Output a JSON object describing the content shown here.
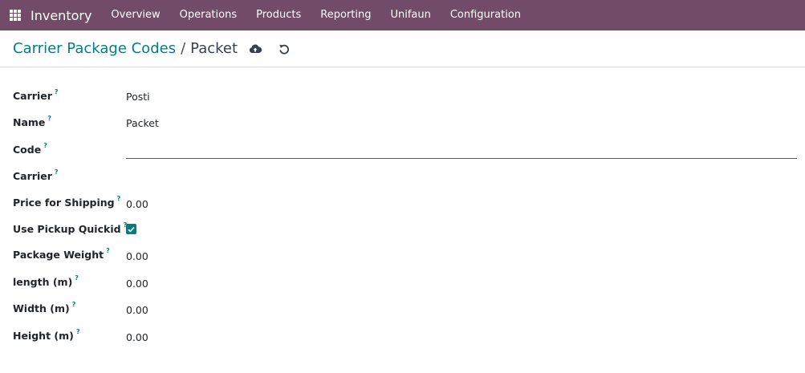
{
  "navbar": {
    "app_name": "Inventory",
    "menu": [
      "Overview",
      "Operations",
      "Products",
      "Reporting",
      "Unifaun",
      "Configuration"
    ]
  },
  "breadcrumb": {
    "parent": "Carrier Package Codes",
    "separator": "/",
    "current": "Packet"
  },
  "icons": {
    "apps": "apps-grid-icon",
    "save": "cloud-upload-icon",
    "discard": "undo-icon"
  },
  "colors": {
    "navbar_bg": "#714b67",
    "accent": "#017e84"
  },
  "form": {
    "help_marker": "?",
    "fields": {
      "carrier": {
        "label": "Carrier",
        "value": "Posti"
      },
      "name": {
        "label": "Name",
        "value": "Packet"
      },
      "code": {
        "label": "Code",
        "value": ""
      },
      "carrier2": {
        "label": "Carrier",
        "value": ""
      },
      "price_for_shipping": {
        "label": "Price for Shipping",
        "value": "0.00"
      },
      "use_pickup_quickid": {
        "label": "Use Pickup Quickid",
        "checked": true
      },
      "package_weight": {
        "label": "Package Weight",
        "value": "0.00"
      },
      "length": {
        "label": "length (m)",
        "value": "0.00"
      },
      "width": {
        "label": "Width (m)",
        "value": "0.00"
      },
      "height": {
        "label": "Height (m)",
        "value": "0.00"
      }
    }
  }
}
